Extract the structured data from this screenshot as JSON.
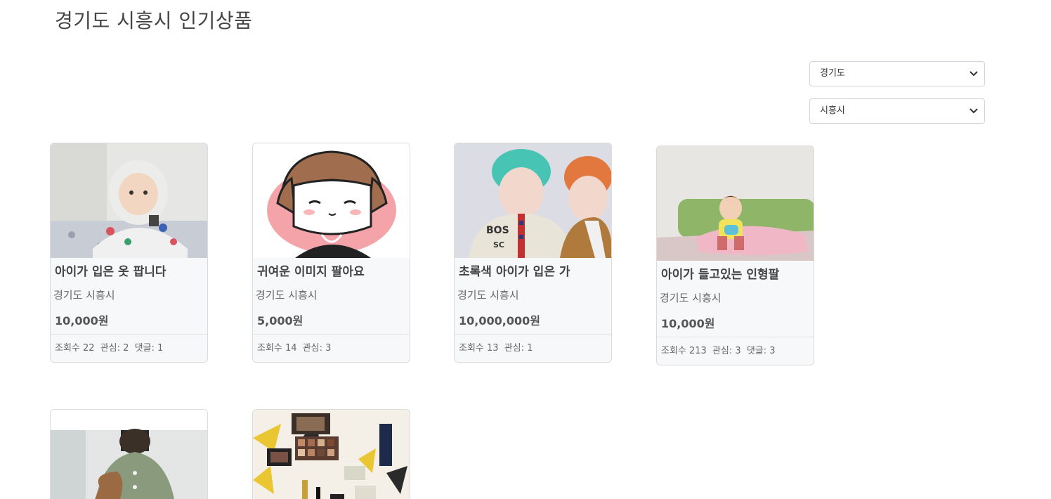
{
  "page": {
    "title": "경기도 시흥시 인기상품"
  },
  "filters": {
    "province": "경기도",
    "city": "시흥시"
  },
  "products": [
    {
      "title": "아이가 입은 옷 팝니다",
      "region": "경기도 시흥시",
      "price": "10,000원",
      "views": "조회수 22",
      "likes": "관심: 2",
      "comments": "댓글: 1",
      "image": "child-in-hoodie-photo"
    },
    {
      "title": "귀여운 이미지 팔아요",
      "region": "경기도 시흥시",
      "price": "5,000원",
      "views": "조회수 14",
      "likes": "관심: 3",
      "comments": "",
      "image": "cartoon-character-illustration"
    },
    {
      "title": "초록색 아이가 입은 가",
      "region": "경기도 시흥시",
      "price": "10,000,000원",
      "views": "조회수 13",
      "likes": "관심: 1",
      "comments": "",
      "image": "two-people-selfie-photo"
    },
    {
      "title": "아이가 들고있는 인형팔",
      "region": "경기도 시흥시",
      "price": "10,000원",
      "views": "조회수 213",
      "likes": "관심: 3",
      "comments": "댓글: 3",
      "image": "child-on-bed-photo"
    },
    {
      "title": "",
      "region": "",
      "price": "",
      "views": "",
      "likes": "",
      "comments": "",
      "image": "person-in-cardigan-photo"
    },
    {
      "title": "",
      "region": "",
      "price": "",
      "views": "",
      "likes": "",
      "comments": "",
      "image": "makeup-palette-photo"
    }
  ],
  "colors": {
    "card_bg": "#f7f8fa",
    "border": "#dcdcdc",
    "text": "#444444"
  }
}
